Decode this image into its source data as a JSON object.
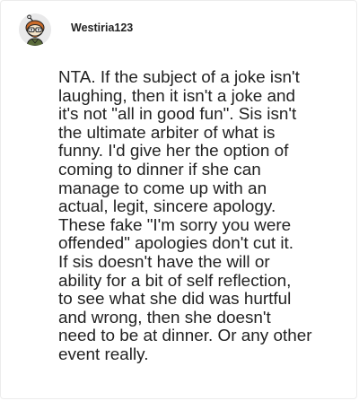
{
  "comment": {
    "username": "Westiria123",
    "avatar_icon": "snoo-avatar-icon",
    "text": "NTA. If the subject of a joke isn't\nlaughing, then it isn't a joke and\nit's not \"all in good fun\". Sis isn't\nthe ultimate arbiter of what is\nfunny. I'd give her the option of\ncoming to dinner if she can\nmanage to come up with an\nactual, legit, sincere apology.\nThese fake \"I'm sorry you were\noffended\" apologies don't cut it.\nIf sis doesn't have the will or\nability for a bit of self reflection,\nto see what she did was hurtful\nand wrong, then she doesn't\nneed to be at dinner. Or any other\nevent really."
  },
  "colors": {
    "text": "#222222",
    "avatar_bg": "#e9e9ea",
    "card_border": "#ececec"
  }
}
